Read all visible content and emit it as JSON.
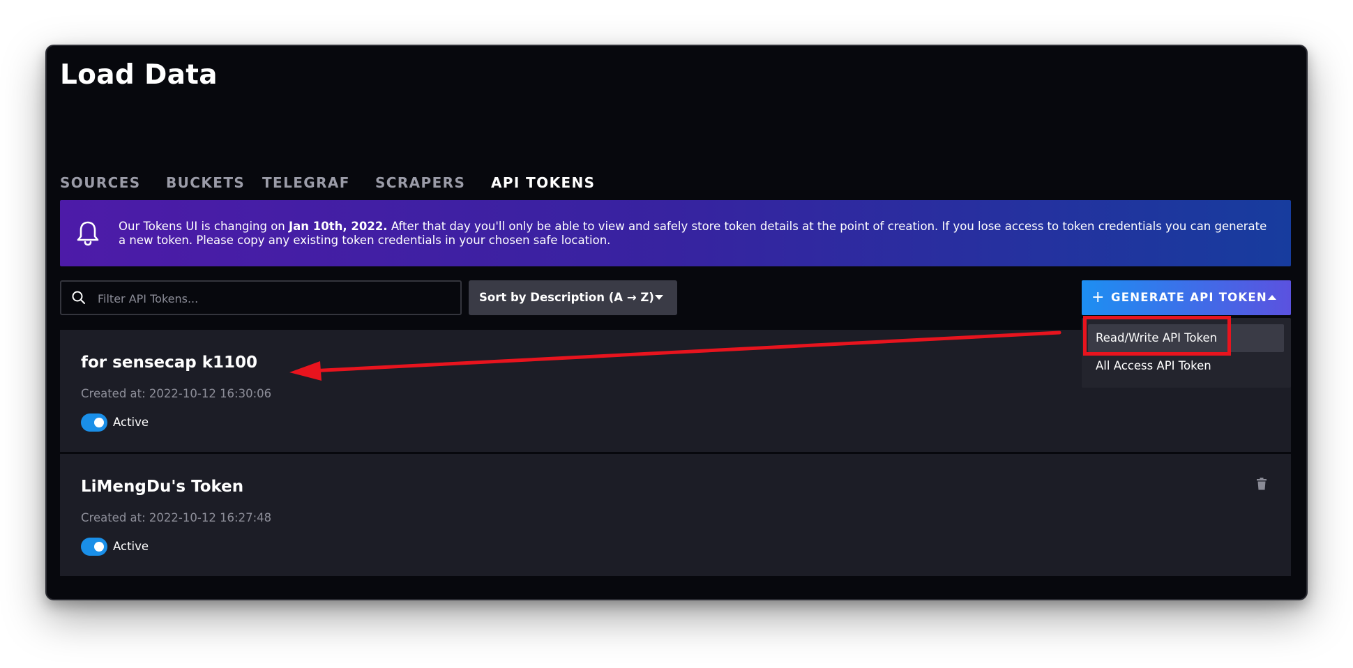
{
  "page": {
    "title": "Load Data"
  },
  "tabs": [
    {
      "label": "SOURCES",
      "active": false
    },
    {
      "label": "BUCKETS",
      "active": false
    },
    {
      "label": "TELEGRAF",
      "active": false
    },
    {
      "label": "SCRAPERS",
      "active": false
    },
    {
      "label": "API TOKENS",
      "active": true
    }
  ],
  "banner": {
    "icon": "bell-icon",
    "text_before": "Our Tokens UI is changing on ",
    "date": "Jan 10th, 2022.",
    "text_after": " After that day you'll only be able to view and safely store token details at the point of creation. If you lose access to token credentials you can generate a new token. Please copy any existing token credentials in your chosen safe location."
  },
  "filter": {
    "icon": "search-icon",
    "placeholder": "Filter API Tokens...",
    "value": ""
  },
  "sort": {
    "label": "Sort by Description (A → Z)"
  },
  "generate": {
    "icon": "plus-icon",
    "label": "GENERATE API TOKEN",
    "menu": [
      {
        "label": "Read/Write API Token"
      },
      {
        "label": "All Access API Token"
      }
    ]
  },
  "tokens": [
    {
      "name": "for sensecap k1100",
      "created": "Created at: 2022-10-12 16:30:06",
      "status": "Active",
      "active": true
    },
    {
      "name": "LiMengDu's Token",
      "created": "Created at: 2022-10-12 16:27:48",
      "status": "Active",
      "active": true
    }
  ],
  "colors": {
    "background": "#07080d",
    "card": "#1c1d26",
    "accent": "#1a8fe8",
    "annotation": "#e8141e"
  }
}
